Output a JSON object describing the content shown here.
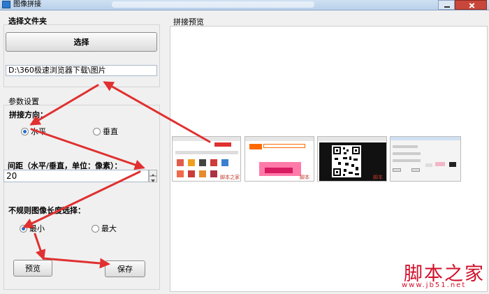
{
  "window": {
    "title": "图像拼接"
  },
  "folder": {
    "title": "选择文件夹",
    "button": "选择",
    "path": "D:\\360极速浏览器下载\\图片"
  },
  "params": {
    "title": "参数设置",
    "direction": {
      "title": "拼接方向：",
      "options": [
        "水平",
        "垂直"
      ],
      "selected": "水平"
    },
    "spacing": {
      "title": "间距（水平/垂直，单位：像素）：",
      "value": "20"
    },
    "irregular": {
      "title": "不规则图像长度选择：",
      "options": [
        "最小",
        "最大"
      ],
      "selected": "最小"
    }
  },
  "buttons": {
    "preview": "预览",
    "save": "保存"
  },
  "preview": {
    "title": "拼接预览"
  },
  "watermark": {
    "small": "脚本之家",
    "logo": "脚本之家",
    "url": "www.jb51.net"
  },
  "colors": {
    "accent": "#1f6fd1",
    "arrow": "#e03030",
    "logo": "#d0102a"
  }
}
